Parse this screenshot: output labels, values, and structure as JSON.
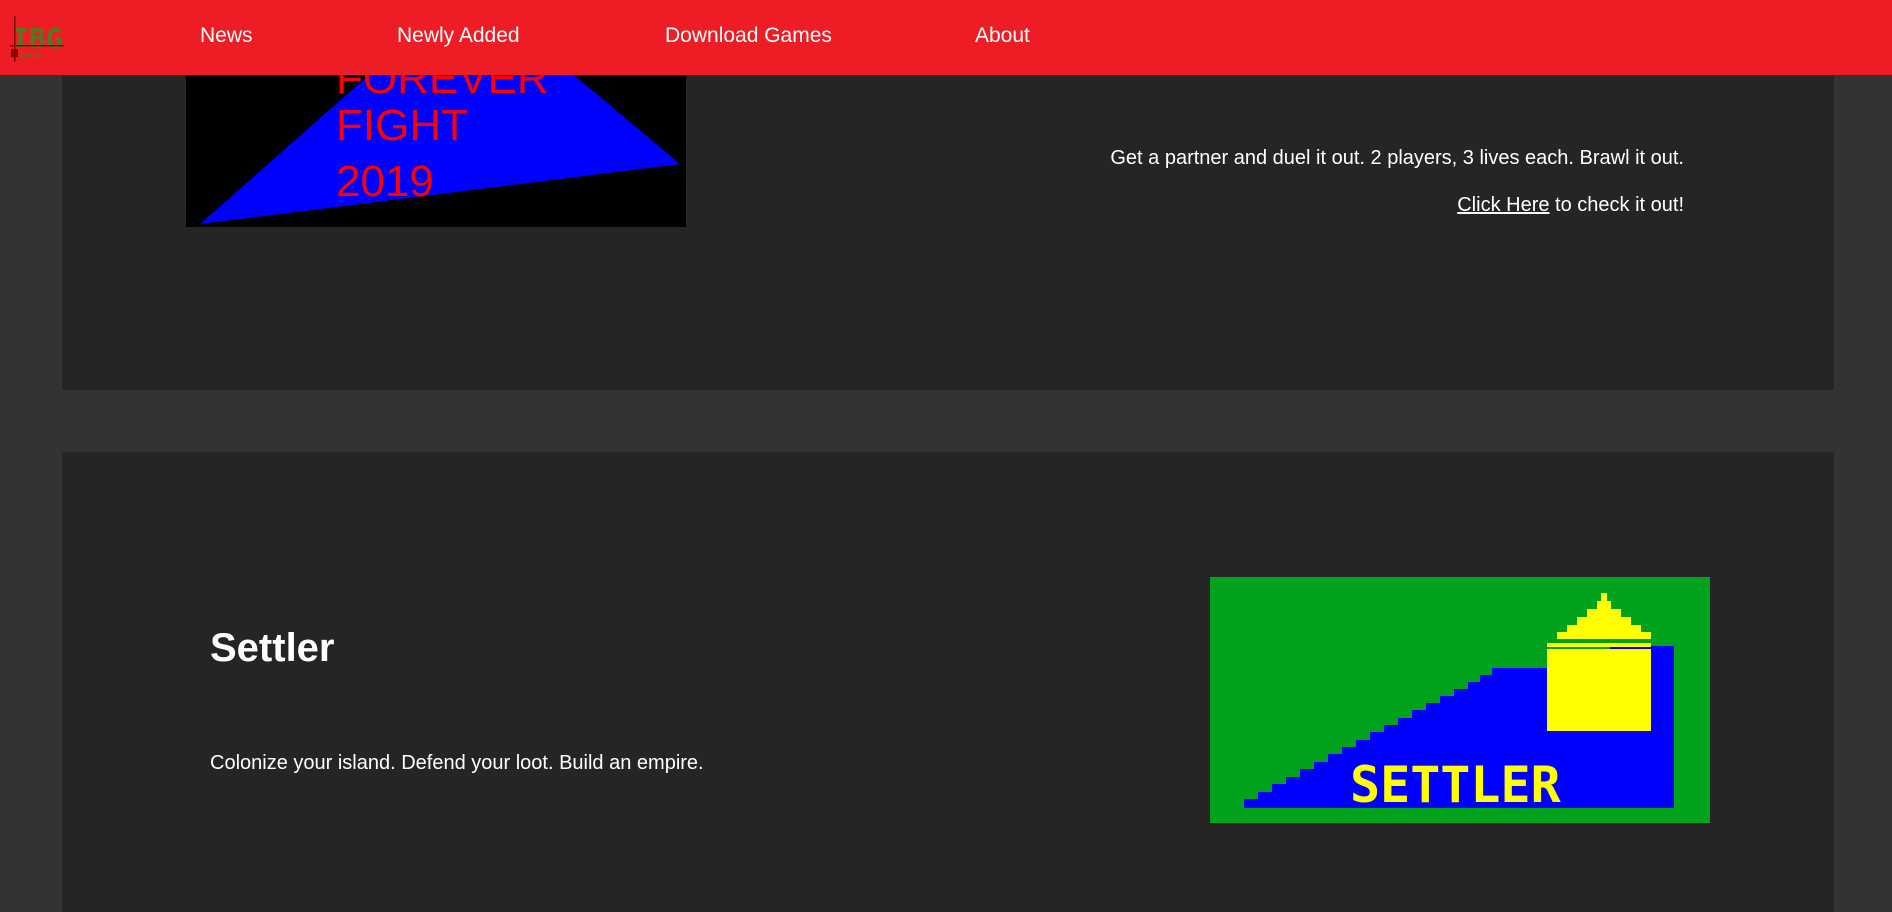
{
  "nav": {
    "logo_text": "IBG",
    "logo_subtext": "GAMING",
    "items": [
      {
        "label": "News"
      },
      {
        "label": "Newly Added"
      },
      {
        "label": "Download Games"
      },
      {
        "label": "About"
      }
    ]
  },
  "games": [
    {
      "image_text": [
        "FOREVER",
        "FIGHT",
        "2019"
      ],
      "description": "Get a partner and duel it out. 2 players, 3 lives each. Brawl it out.",
      "cta_link": "Click Here",
      "cta_suffix": " to check it out!"
    },
    {
      "title": "Settler",
      "description": "Colonize your island. Defend your loot. Build an empire.",
      "image_text": "SETTLER"
    }
  ],
  "colors": {
    "nav_bg": "#ee1c25",
    "page_bg": "#333333",
    "card_bg": "#252525",
    "ff_triangle": "#0000ff",
    "ff_text": "#ff0000",
    "settler_bg": "#00a31b",
    "settler_yellow": "#ffff00",
    "settler_blue": "#0000ff"
  }
}
